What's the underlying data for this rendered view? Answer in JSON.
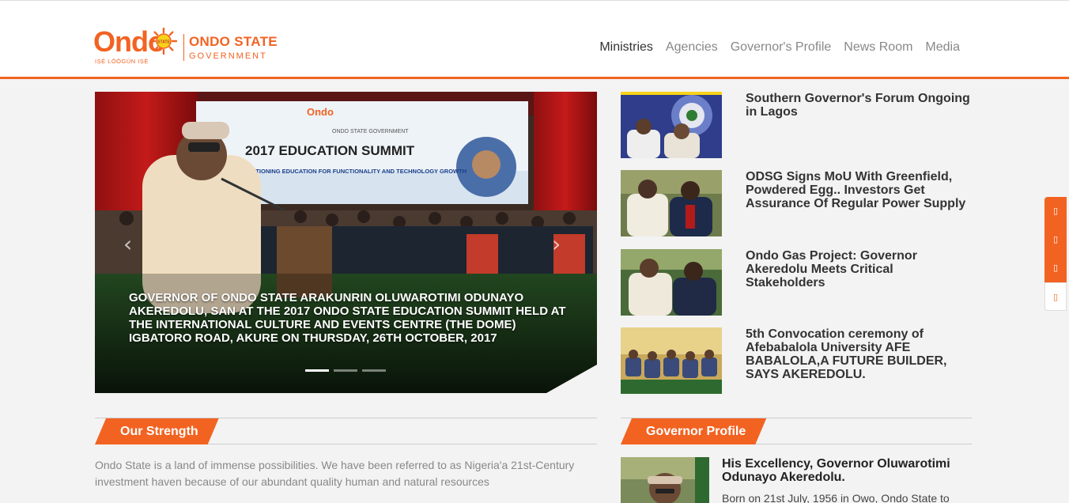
{
  "brand": {
    "logo_word": "Ondo",
    "logo_motto": "IṢẸ́ LÓÒGÙN IṢẸ́",
    "logo_badge": "STATE",
    "title": "ONDO STATE",
    "subtitle": "GOVERNMENT",
    "accent_color": "#f26322"
  },
  "nav": [
    {
      "label": "Ministries",
      "active": true
    },
    {
      "label": "Agencies"
    },
    {
      "label": "Governor's Profile"
    },
    {
      "label": "News Room"
    },
    {
      "label": "Media"
    }
  ],
  "slider": {
    "caption": "Governor of Ondo State Arakunrin Oluwarotimi Odunayo Akeredolu, SAN at the 2017 Ondo State Education Summit held at the International Culture and Events Centre (The Dome) Igbatoro Road, Akure on Thursday, 26th October, 2017",
    "banner_text": "2017 EDUCATION SUMMIT",
    "banner_sub": "REPOSITIONING EDUCATION FOR FUNCTIONALITY AND TECHNOLOGY GROWTH",
    "banner_org": "ONDO STATE GOVERNMENT",
    "prev_icon": "chevron-left-icon",
    "next_icon": "chevron-right-icon",
    "slide_count": 3,
    "active_slide": 1
  },
  "news": [
    {
      "title": "Southern Governor's Forum Ongoing in Lagos"
    },
    {
      "title": "ODSG Signs MoU With Greenfield, Powdered Egg.. Investors Get Assurance Of Regular Power Supply"
    },
    {
      "title": "Ondo Gas Project: Governor Akeredolu Meets Critical Stakeholders"
    },
    {
      "title": "5th Convocation ceremony of Afebabalola University AFE BABALOLA,A FUTURE BUILDER, SAYS AKEREDOLU."
    }
  ],
  "strength": {
    "heading": "Our Strength",
    "text": "Ondo State is a land of immense possibilities. We have been referred to as Nigeria'a 21st-Century investment haven because of our abundant quality human and natural resources"
  },
  "governor": {
    "heading": "Governor Profile",
    "title": "His Excellency, Governor Oluwarotimi Odunayo Akeredolu.",
    "bio": "Born on 21st July, 1956 in Owo, Ondo State to"
  },
  "social": [
    {
      "icon": "facebook-icon",
      "glyph": "▯"
    },
    {
      "icon": "twitter-icon",
      "glyph": "▯"
    },
    {
      "icon": "instagram-icon",
      "glyph": "▯"
    },
    {
      "icon": "youtube-icon",
      "glyph": "▯"
    }
  ]
}
